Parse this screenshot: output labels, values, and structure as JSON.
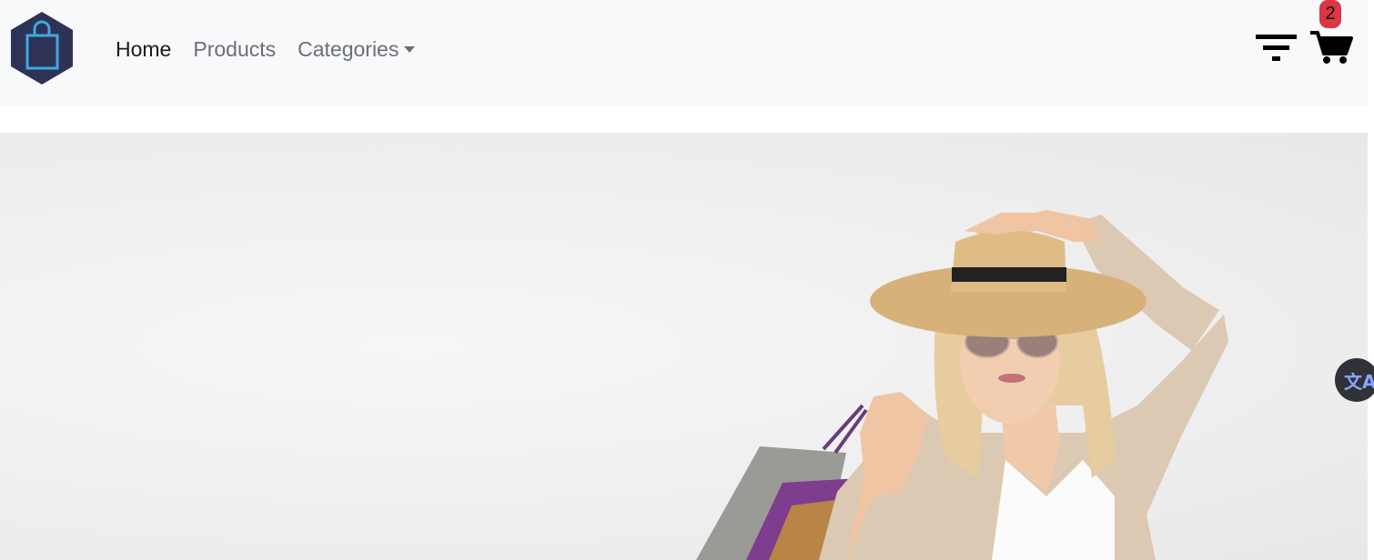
{
  "navbar": {
    "logo_icon": "shopping-bag-icon",
    "links": [
      {
        "label": "Home",
        "active": true
      },
      {
        "label": "Products",
        "active": false
      },
      {
        "label": "Categories",
        "active": false,
        "dropdown": true
      }
    ],
    "filter_icon": "filter-icon",
    "cart_icon": "shopping-cart-icon",
    "cart_count": "2"
  },
  "hero": {
    "image": "woman-with-hat-and-shopping-bags",
    "background_color": "#efefef"
  },
  "translate_widget": {
    "icon": "translate-icon",
    "glyph": "文A"
  },
  "colors": {
    "navbar_bg": "#f8f9fa",
    "badge": "#dc3545",
    "logo_hex": "#2e3256",
    "logo_bag": "#3fa9e0"
  }
}
